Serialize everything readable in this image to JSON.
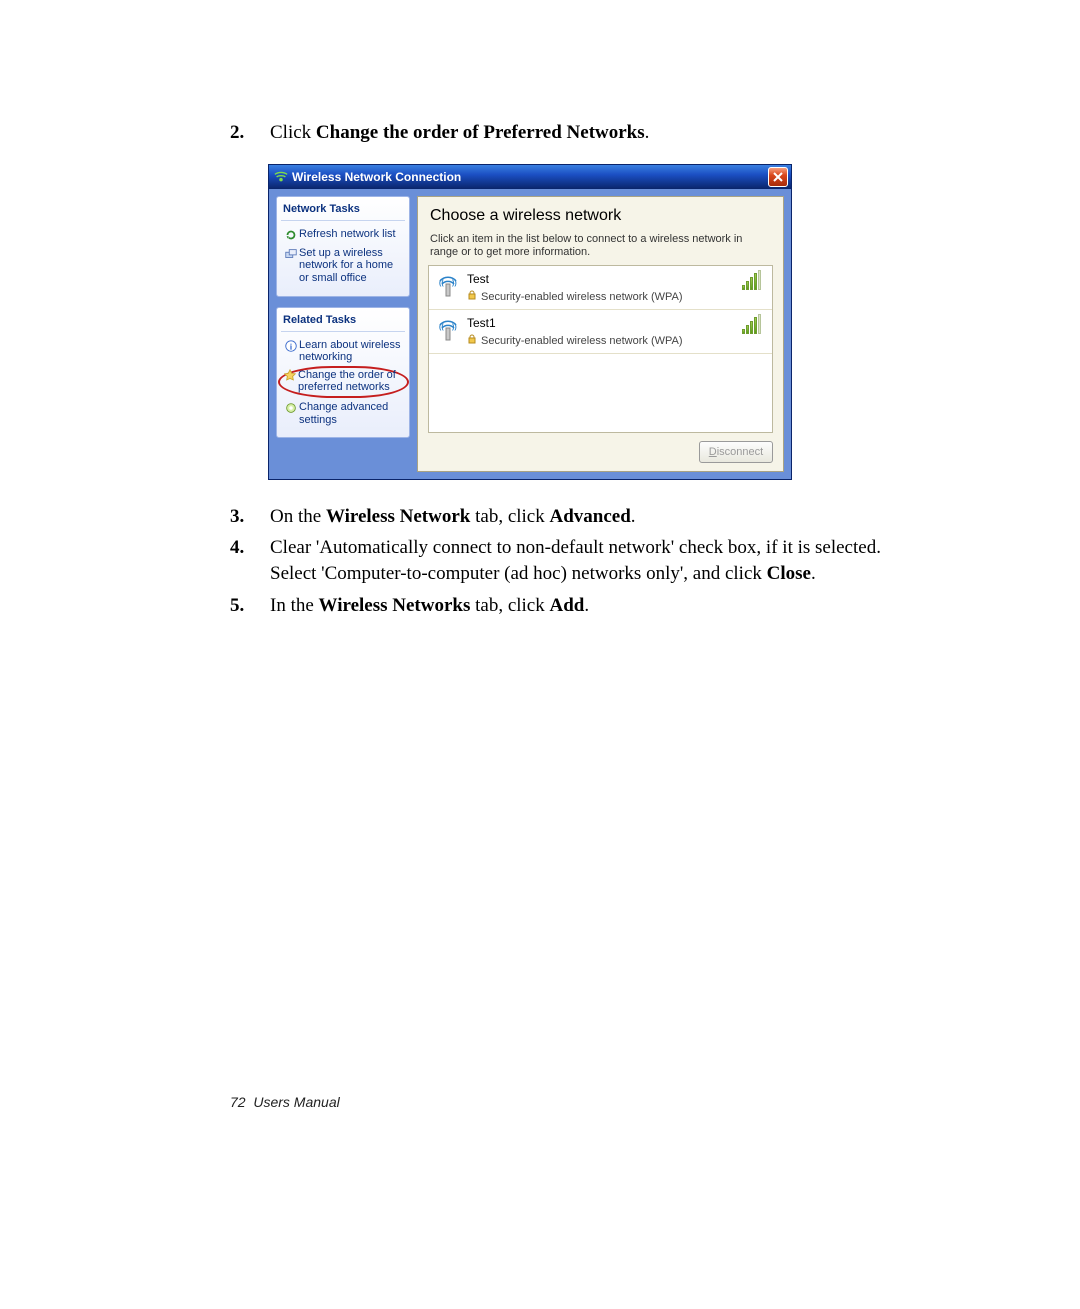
{
  "steps": {
    "s2": {
      "num": "2.",
      "prefix": "Click ",
      "bold": "Change the order of Preferred Networks",
      "suffix": "."
    },
    "s3": {
      "num": "3.",
      "prefix": "On the ",
      "bold1": "Wireless Network",
      "mid": " tab, click ",
      "bold2": "Advanced",
      "suffix": "."
    },
    "s4": {
      "num": "4.",
      "line1": "Clear 'Automatically connect to non-default network' check box, if it is selected.",
      "line2_prefix": "Select 'Computer-to-computer (ad hoc) networks only', and click ",
      "line2_bold": "Close",
      "line2_suffix": "."
    },
    "s5": {
      "num": "5.",
      "prefix": "In the ",
      "bold1": "Wireless Networks",
      "mid": " tab, click ",
      "bold2": "Add",
      "suffix": "."
    }
  },
  "dialog": {
    "title": "Wireless Network Connection",
    "heading": "Choose a wireless network",
    "subtext": "Click an item in the list below to connect to a wireless network in range or to get more information.",
    "sidebar": {
      "panel1_head": "Network Tasks",
      "task1": "Refresh network list",
      "task2": "Set up a wireless network for a home or small office",
      "panel2_head": "Related Tasks",
      "taskA": "Learn about wireless networking",
      "taskB": "Change the order of preferred networks",
      "taskC": "Change advanced settings"
    },
    "networks": [
      {
        "name": "Test",
        "security": "Security-enabled wireless network (WPA)"
      },
      {
        "name": "Test1",
        "security": "Security-enabled wireless network (WPA)"
      }
    ],
    "disconnect_u": "D",
    "disconnect_rest": "isconnect"
  },
  "footer": {
    "pagenum": "72",
    "label": "Users Manual"
  }
}
